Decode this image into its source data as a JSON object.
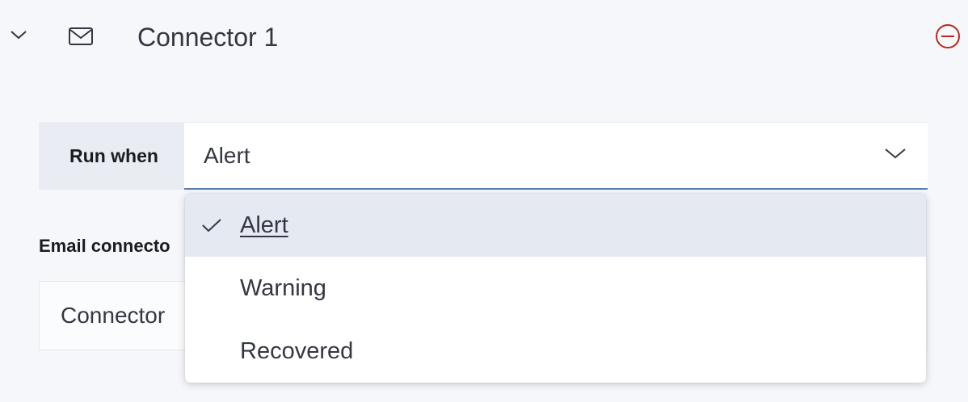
{
  "header": {
    "title": "Connector 1",
    "icons": {
      "collapse": "chevron-down-icon",
      "type": "envelope-icon",
      "remove": "minus-circle-icon"
    },
    "remove_color": "#bd271e"
  },
  "run_when": {
    "label": "Run when",
    "selected": "Alert"
  },
  "email_connector": {
    "label": "Email connecto",
    "value": "Connector"
  },
  "dropdown": {
    "options": [
      {
        "label": "Alert",
        "selected": true
      },
      {
        "label": "Warning",
        "selected": false
      },
      {
        "label": "Recovered",
        "selected": false
      }
    ]
  }
}
